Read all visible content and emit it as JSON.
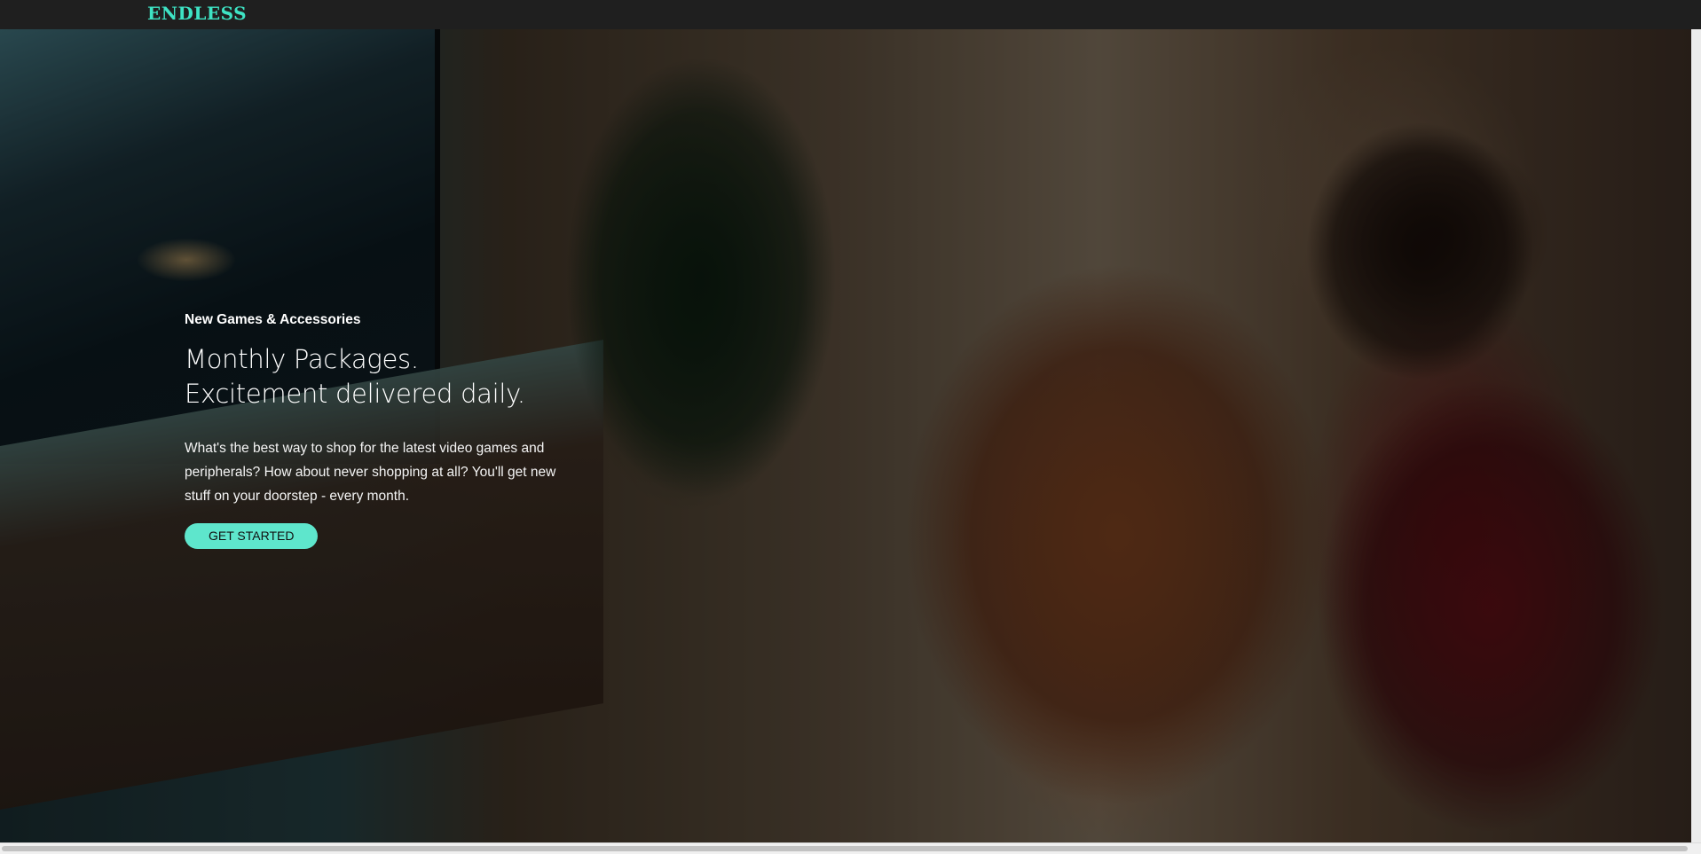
{
  "brand": {
    "logo": "ENDLESS",
    "accent_color": "#3ee3c4"
  },
  "hero": {
    "background_image": "photo of people watching a space game on a TV in a living room",
    "eyebrow": "New Games & Accessories",
    "headline": [
      "Monthly Packages.",
      "Excitement delivered daily."
    ],
    "body": "What's the best way to shop for the latest video games and peripherals? How about never shopping at all? You'll get new stuff on your doorstep - every month.",
    "cta_label": "GET STARTED",
    "cta_color": "#5ee6cc"
  }
}
